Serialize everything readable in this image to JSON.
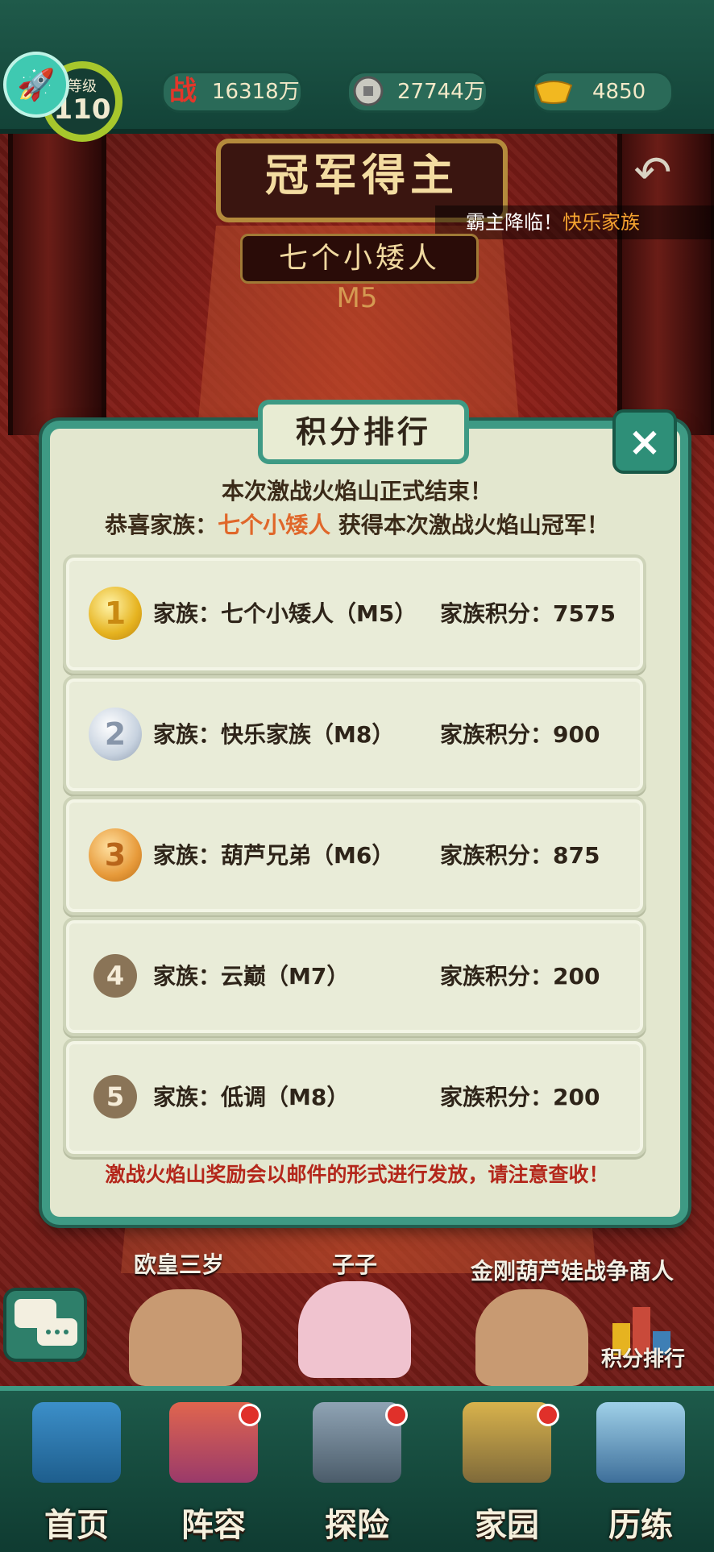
{
  "topbar": {
    "level_label": "等级",
    "level_value": "110",
    "power_icon": "战",
    "power_value": "16318万",
    "coin_value": "27744万",
    "gold_value": "4850"
  },
  "header": {
    "title": "冠军得主",
    "announcement_prefix": "霸主降临！",
    "announcement_name": "快乐家族",
    "champion_name": "七个小矮人",
    "champion_server": "M5"
  },
  "modal": {
    "title": "积分排行",
    "close_icon": "×",
    "message_line1": "本次激战火焰山正式结束！",
    "message_line2_prefix": "恭喜家族：",
    "message_line2_name": "七个小矮人",
    "message_line2_suffix": "获得本次激战火焰山冠军！",
    "rows": [
      {
        "rank": "1",
        "family": "家族：七个小矮人（M5）",
        "score": "家族积分：7575"
      },
      {
        "rank": "2",
        "family": "家族：快乐家族（M8）",
        "score": "家族积分：900"
      },
      {
        "rank": "3",
        "family": "家族：葫芦兄弟（M6）",
        "score": "家族积分：875"
      },
      {
        "rank": "4",
        "family": "家族：云巅（M7）",
        "score": "家族积分：200"
      },
      {
        "rank": "5",
        "family": "家族：低调（M8）",
        "score": "家族积分：200"
      }
    ],
    "footnote": "激战火焰山奖励会以邮件的形式进行发放，请注意查收！"
  },
  "npcs": {
    "left": "欧皇三岁",
    "center": "子子",
    "right": "金刚葫芦娃战争商人",
    "ranking_button": "积分排行"
  },
  "nav": {
    "home": "首页",
    "lineup": "阵容",
    "explore": "探险",
    "homestead": "家园",
    "training": "历练"
  }
}
